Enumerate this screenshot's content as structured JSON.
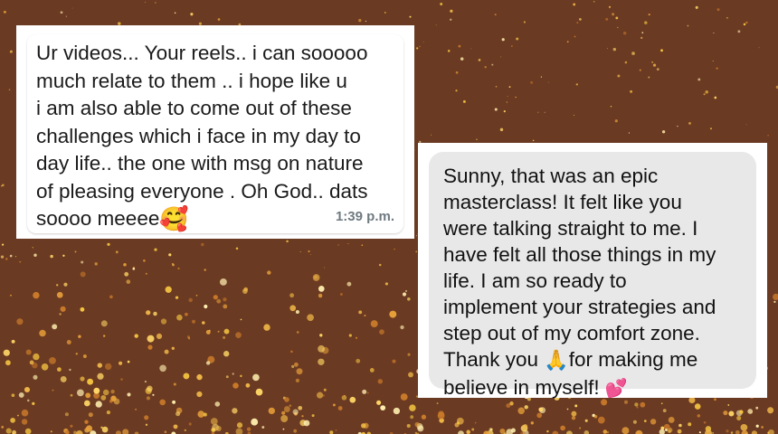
{
  "colors": {
    "background": "#6b3a22",
    "bubble_left": "#ffffff",
    "bubble_right": "#e8e8e8",
    "confetti": [
      "#f5c542",
      "#ffd766",
      "#e8a13a",
      "#fff0b0",
      "#f0b848",
      "#c97a2a"
    ]
  },
  "left_message": {
    "text": "Ur videos... Your reels.. i can sooooo\nmuch relate to them .. i hope like u\ni am also able to come out of these\nchallenges which i face in my day to\nday life.. the one with msg on nature\nof pleasing everyone . Oh God.. dats\nsoooo meeee",
    "emoji": "🥰",
    "emoji_icon": "smiling-face-with-hearts-icon",
    "time": "1:39 p.m."
  },
  "right_message": {
    "text_before_pray": "Sunny, that was an epic\nmasterclass! It felt like you\nwere talking straight to me. I\nhave felt all those things in my\nlife. I am so ready to\nimplement your strategies and\nstep out of my comfort zone.\nThank you ",
    "pray_emoji": "🙏",
    "pray_icon": "folded-hands-icon",
    "text_after_pray": "for making me\nbelieve in myself! ",
    "heart_emoji": "💕",
    "heart_icon": "two-hearts-icon"
  }
}
